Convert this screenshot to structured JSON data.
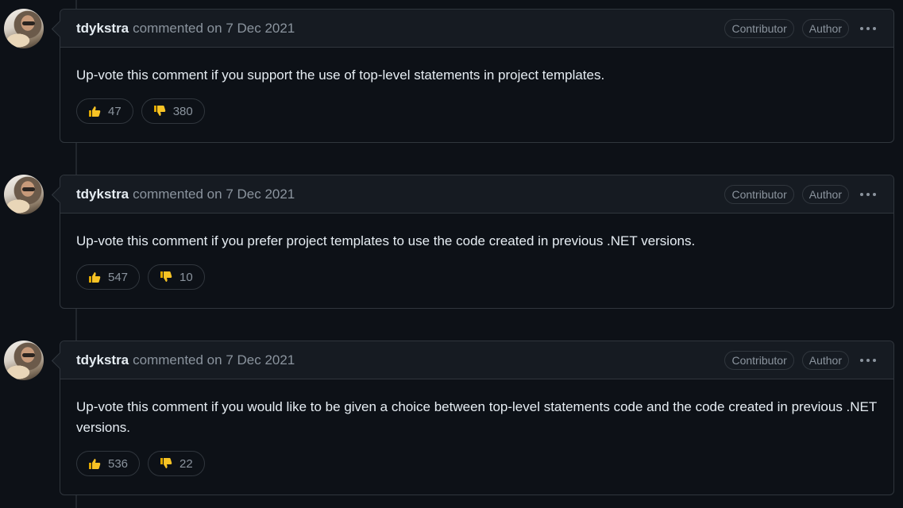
{
  "comments": [
    {
      "author": "tdykstra",
      "meta": "commented on 7 Dec 2021",
      "labels": [
        "Contributor",
        "Author"
      ],
      "body": "Up-vote this comment if you support the use of top-level statements in project templates.",
      "reactions": {
        "thumbs_up": "47",
        "thumbs_down": "380"
      }
    },
    {
      "author": "tdykstra",
      "meta": "commented on 7 Dec 2021",
      "labels": [
        "Contributor",
        "Author"
      ],
      "body": "Up-vote this comment if you prefer project templates to use the code created in previous .NET versions.",
      "reactions": {
        "thumbs_up": "547",
        "thumbs_down": "10"
      }
    },
    {
      "author": "tdykstra",
      "meta": "commented on 7 Dec 2021",
      "labels": [
        "Contributor",
        "Author"
      ],
      "body": "Up-vote this comment if you would like to be given a choice between top-level statements code and the code created in previous .NET versions.",
      "reactions": {
        "thumbs_up": "536",
        "thumbs_down": "22"
      }
    }
  ],
  "icons": {
    "thumbs_up": "thumbs-up-icon",
    "thumbs_down": "thumbs-down-icon",
    "kebab": "kebab-horizontal-icon"
  },
  "colors": {
    "background": "#0d1117",
    "header": "#161b22",
    "border": "#30363d",
    "muted_text": "#8b949e",
    "text": "#e6edf3",
    "emoji": "#f7c325"
  }
}
